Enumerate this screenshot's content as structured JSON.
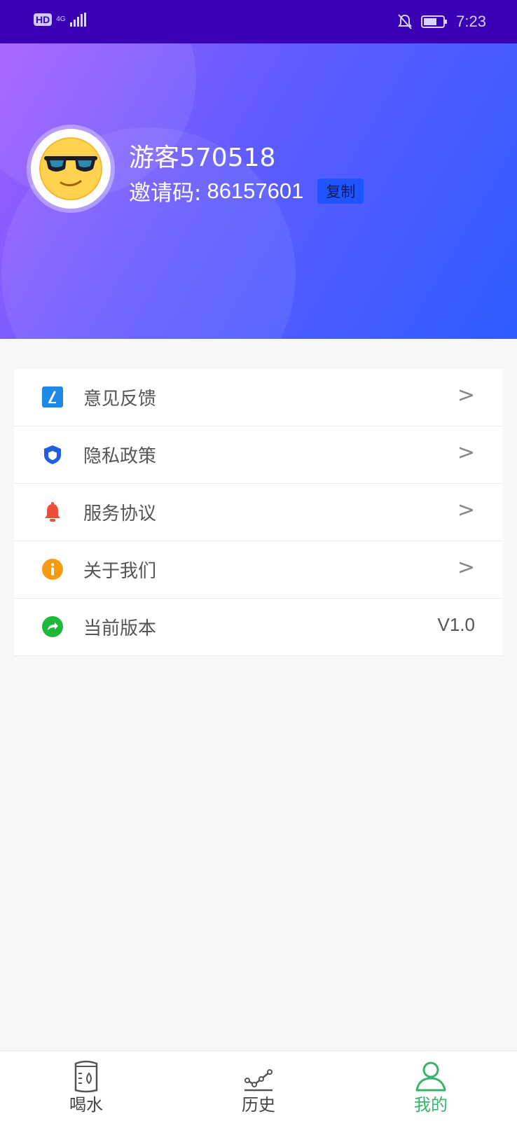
{
  "status_bar": {
    "left_badge": "HD",
    "network": "4G",
    "time": "7:23"
  },
  "profile": {
    "username": "游客570518",
    "invite_label": "邀请码:",
    "invite_code": "86157601",
    "copy_label": "复制"
  },
  "menu": [
    {
      "label": "意见反馈",
      "icon": "feedback-icon",
      "icon_color": "#1e88e5",
      "trailing": ">"
    },
    {
      "label": "隐私政策",
      "icon": "shield-icon",
      "icon_color": "#1f5fe0",
      "trailing": ">"
    },
    {
      "label": "服务协议",
      "icon": "bell-icon",
      "icon_color": "#f24b3a",
      "trailing": ">"
    },
    {
      "label": "关于我们",
      "icon": "info-icon",
      "icon_color": "#f59b12",
      "trailing": ">"
    },
    {
      "label": "当前版本",
      "icon": "share-icon",
      "icon_color": "#1fb83a",
      "trailing": "V1.0"
    }
  ],
  "tabs": [
    {
      "label": "喝水",
      "icon": "water-cup-icon",
      "active": false
    },
    {
      "label": "历史",
      "icon": "chart-line-icon",
      "active": false
    },
    {
      "label": "我的",
      "icon": "user-icon",
      "active": true
    }
  ],
  "colors": {
    "accent_green": "#36b46c",
    "header_start": "#a35cff",
    "header_end": "#2e5cff"
  }
}
